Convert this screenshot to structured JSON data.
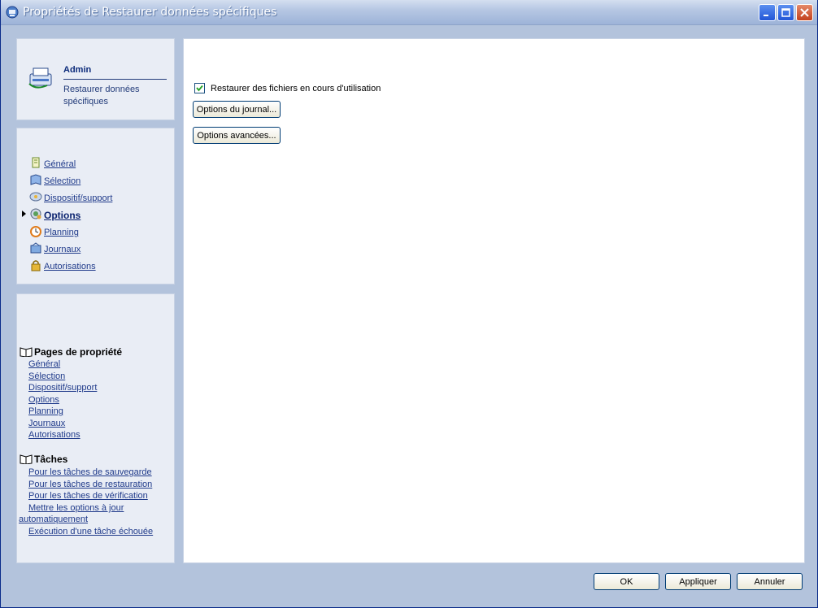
{
  "window": {
    "title": "Propriétés de Restaurer données spécifiques"
  },
  "header": {
    "title": "Admin",
    "subtitle": "Restaurer données spécifiques"
  },
  "nav": {
    "items": [
      {
        "label": "Général",
        "icon": "general-page-icon",
        "active": false
      },
      {
        "label": "Sélection",
        "icon": "selection-book-icon",
        "active": false
      },
      {
        "label": "Dispositif/support",
        "icon": "device-drive-icon",
        "active": false
      },
      {
        "label": "Options",
        "icon": "options-gear-icon",
        "active": true
      },
      {
        "label": "Planning",
        "icon": "planning-clock-icon",
        "active": false
      },
      {
        "label": "Journaux",
        "icon": "journals-book-icon",
        "active": false
      },
      {
        "label": "Autorisations",
        "icon": "permissions-lock-icon",
        "active": false
      }
    ]
  },
  "help": {
    "property_pages_heading": "Pages de propriété",
    "property_pages": [
      "Général",
      "Sélection",
      "Dispositif/support",
      "Options",
      "Planning",
      "Journaux",
      "Autorisations"
    ],
    "tasks_heading": "Tâches",
    "tasks": [
      "Pour les tâches de sauvegarde",
      "Pour les tâches de restauration",
      "Pour les tâches de vérification",
      "Mettre les options à jour",
      "automatiquement",
      "Exécution d'une tâche échouée"
    ]
  },
  "options": {
    "restore_in_use_label": "Restaurer des fichiers en cours d'utilisation",
    "restore_in_use_checked": true,
    "journal_button": "Options du journal...",
    "advanced_button": "Options avancées..."
  },
  "footer": {
    "ok": "OK",
    "apply": "Appliquer",
    "cancel": "Annuler"
  },
  "colors": {
    "title_gradient_start": "#d4dff0",
    "frame_background": "#b3c3dc",
    "panel_background": "#e9edf5",
    "link": "#1f3a8a"
  }
}
